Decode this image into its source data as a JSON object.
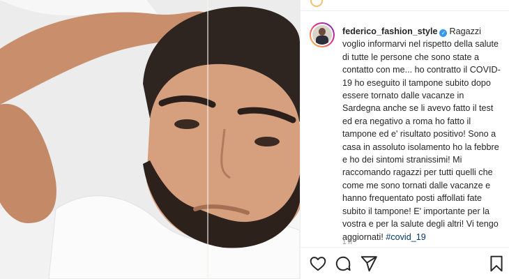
{
  "post": {
    "username": "federico_fashion_style",
    "verified_symbol": "✓",
    "caption": "Ragazzi voglio informarvi nel rispetto della salute di tutte le persone che sono state a contatto con me... ho contratto il COVID-19 ho eseguito il tampone subito dopo essere tornato dalle vacanze in Sardegna anche se li avevo fatto il test ed era negativo a roma ho fatto il tampone ed e' risultato positivo! Sono a casa in assoluto isolamento ho la febbre e ho dei sintomi stranissimi! Mi raccomando ragazzi per tutti quelli che come me sono tornati dalle vacanze e hanno frequentato posti affollati fate subito il tampone! E' importante per la vostra e per la salute degli altri! Vi tengo aggiornati!",
    "hashtag": "#covid_19",
    "timestamp": "1 h"
  },
  "icons": {
    "like": "heart-icon",
    "comment": "comment-icon",
    "share": "paper-plane-icon",
    "save": "bookmark-icon"
  },
  "colors": {
    "verified": "#3897f0",
    "hashtag": "#00376b",
    "text": "#262626",
    "muted": "#8e8e8e",
    "border": "#efefef"
  }
}
